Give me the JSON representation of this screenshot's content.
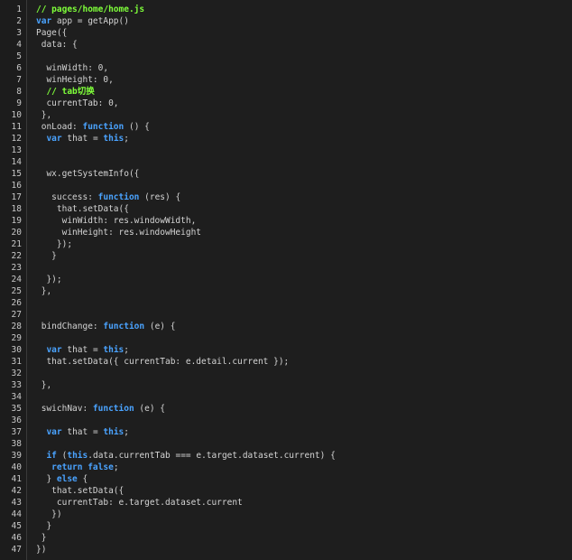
{
  "colors": {
    "background": "#1e1e1e",
    "gutter": "#1c1c1c",
    "comment": "#7fff3a",
    "keyword": "#4aa3ff",
    "plain": "#d4d4d4"
  },
  "lines": [
    [
      {
        "t": "comment",
        "v": "// pages/home/home.js"
      }
    ],
    [
      {
        "t": "keyword",
        "v": "var"
      },
      {
        "t": "plain",
        "v": " app = getApp()"
      }
    ],
    [
      {
        "t": "plain",
        "v": "Page({"
      }
    ],
    [
      {
        "t": "plain",
        "v": " data: {"
      }
    ],
    [],
    [
      {
        "t": "plain",
        "v": "  winWidth: 0,"
      }
    ],
    [
      {
        "t": "plain",
        "v": "  winHeight: 0,"
      }
    ],
    [
      {
        "t": "comment",
        "v": "  // tab切换"
      }
    ],
    [
      {
        "t": "plain",
        "v": "  currentTab: 0,"
      }
    ],
    [
      {
        "t": "plain",
        "v": " },"
      }
    ],
    [
      {
        "t": "plain",
        "v": " onLoad: "
      },
      {
        "t": "keyword",
        "v": "function"
      },
      {
        "t": "plain",
        "v": " () {"
      }
    ],
    [
      {
        "t": "plain",
        "v": "  "
      },
      {
        "t": "keyword",
        "v": "var"
      },
      {
        "t": "plain",
        "v": " that = "
      },
      {
        "t": "keyword",
        "v": "this"
      },
      {
        "t": "plain",
        "v": ";"
      }
    ],
    [],
    [],
    [
      {
        "t": "plain",
        "v": "  wx.getSystemInfo({"
      }
    ],
    [],
    [
      {
        "t": "plain",
        "v": "   success: "
      },
      {
        "t": "keyword",
        "v": "function"
      },
      {
        "t": "plain",
        "v": " (res) {"
      }
    ],
    [
      {
        "t": "plain",
        "v": "    that.setData({"
      }
    ],
    [
      {
        "t": "plain",
        "v": "     winWidth: res.windowWidth,"
      }
    ],
    [
      {
        "t": "plain",
        "v": "     winHeight: res.windowHeight"
      }
    ],
    [
      {
        "t": "plain",
        "v": "    });"
      }
    ],
    [
      {
        "t": "plain",
        "v": "   }"
      }
    ],
    [],
    [
      {
        "t": "plain",
        "v": "  });"
      }
    ],
    [
      {
        "t": "plain",
        "v": " },"
      }
    ],
    [],
    [],
    [
      {
        "t": "plain",
        "v": " bindChange: "
      },
      {
        "t": "keyword",
        "v": "function"
      },
      {
        "t": "plain",
        "v": " (e) {"
      }
    ],
    [],
    [
      {
        "t": "plain",
        "v": "  "
      },
      {
        "t": "keyword",
        "v": "var"
      },
      {
        "t": "plain",
        "v": " that = "
      },
      {
        "t": "keyword",
        "v": "this"
      },
      {
        "t": "plain",
        "v": ";"
      }
    ],
    [
      {
        "t": "plain",
        "v": "  that.setData({ currentTab: e.detail.current });"
      }
    ],
    [],
    [
      {
        "t": "plain",
        "v": " },"
      }
    ],
    [],
    [
      {
        "t": "plain",
        "v": " swichNav: "
      },
      {
        "t": "keyword",
        "v": "function"
      },
      {
        "t": "plain",
        "v": " (e) {"
      }
    ],
    [],
    [
      {
        "t": "plain",
        "v": "  "
      },
      {
        "t": "keyword",
        "v": "var"
      },
      {
        "t": "plain",
        "v": " that = "
      },
      {
        "t": "keyword",
        "v": "this"
      },
      {
        "t": "plain",
        "v": ";"
      }
    ],
    [],
    [
      {
        "t": "plain",
        "v": "  "
      },
      {
        "t": "keyword",
        "v": "if"
      },
      {
        "t": "plain",
        "v": " ("
      },
      {
        "t": "keyword",
        "v": "this"
      },
      {
        "t": "plain",
        "v": ".data.currentTab === e.target.dataset.current) {"
      }
    ],
    [
      {
        "t": "plain",
        "v": "   "
      },
      {
        "t": "keyword",
        "v": "return false"
      },
      {
        "t": "plain",
        "v": ";"
      }
    ],
    [
      {
        "t": "plain",
        "v": "  } "
      },
      {
        "t": "keyword",
        "v": "else"
      },
      {
        "t": "plain",
        "v": " {"
      }
    ],
    [
      {
        "t": "plain",
        "v": "   that.setData({"
      }
    ],
    [
      {
        "t": "plain",
        "v": "    currentTab: e.target.dataset.current"
      }
    ],
    [
      {
        "t": "plain",
        "v": "   })"
      }
    ],
    [
      {
        "t": "plain",
        "v": "  }"
      }
    ],
    [
      {
        "t": "plain",
        "v": " }"
      }
    ],
    [
      {
        "t": "plain",
        "v": "})"
      }
    ]
  ],
  "line_numbers": [
    "1",
    "2",
    "3",
    "4",
    "5",
    "6",
    "7",
    "8",
    "9",
    "10",
    "11",
    "12",
    "13",
    "14",
    "15",
    "16",
    "17",
    "18",
    "19",
    "20",
    "21",
    "22",
    "23",
    "24",
    "25",
    "26",
    "27",
    "28",
    "29",
    "30",
    "31",
    "32",
    "33",
    "34",
    "35",
    "36",
    "37",
    "38",
    "39",
    "40",
    "41",
    "42",
    "43",
    "44",
    "45",
    "46",
    "47"
  ]
}
